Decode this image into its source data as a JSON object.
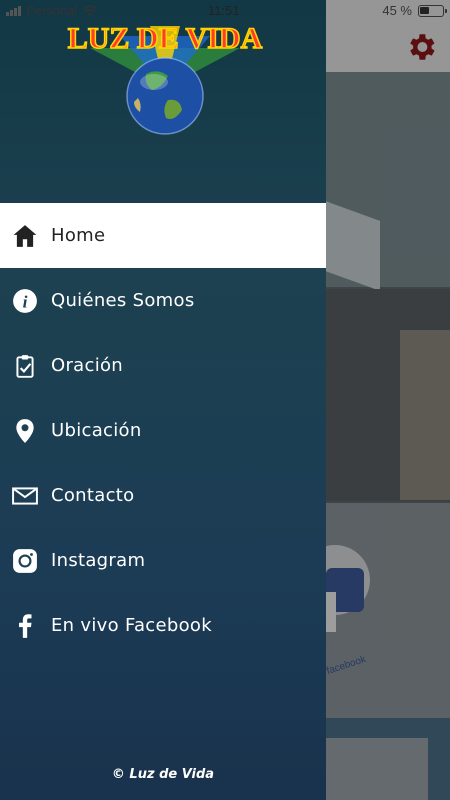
{
  "status_bar": {
    "carrier": "Personal",
    "time": "11:51",
    "battery": "45 %",
    "battery_level": 0.45
  },
  "drawer": {
    "logo_text": "LUZ DE VIDA",
    "menu": [
      {
        "label": "Home",
        "icon": "home-icon",
        "active": true
      },
      {
        "label": "Quiénes Somos",
        "icon": "info-icon",
        "active": false
      },
      {
        "label": "Oración",
        "icon": "clipboard-check-icon",
        "active": false
      },
      {
        "label": "Ubicación",
        "icon": "location-pin-icon",
        "active": false
      },
      {
        "label": "Contacto",
        "icon": "envelope-icon",
        "active": false
      },
      {
        "label": "Instagram",
        "icon": "instagram-icon",
        "active": false
      },
      {
        "label": "En vivo Facebook",
        "icon": "facebook-icon",
        "active": false
      }
    ],
    "footer": "© Luz de Vida"
  },
  "background": {
    "settings_icon": "gear-icon",
    "facebook_text": "facebook"
  },
  "colors": {
    "drawer_top": "#123845",
    "drawer_bottom": "#19324d",
    "active_bg": "#ffffff",
    "gear": "#8b1a1a"
  }
}
